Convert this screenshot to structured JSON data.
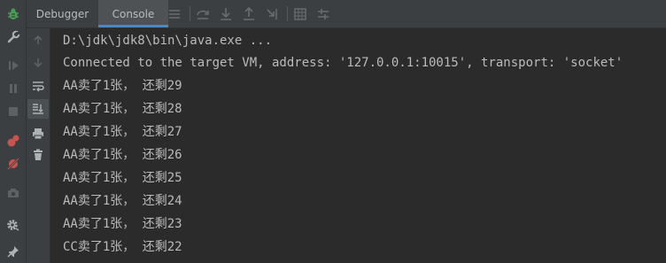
{
  "tabs": [
    {
      "label": "Debugger",
      "selected": false
    },
    {
      "label": "Console",
      "selected": true
    }
  ],
  "colors": {
    "background": "#2b2b2b",
    "panel": "#3c3f41",
    "text": "#bbbbbb",
    "accent": "#4a88c7",
    "debug_green": "#499c54",
    "breakpoint_red": "#c75450"
  },
  "left_rail_icons": [
    "debug-bug-icon",
    "wrench-icon",
    "resume-icon",
    "pause-icon",
    "stop-icon",
    "view-breakpoints-icon",
    "mute-breakpoints-icon",
    "camera-icon",
    "settings-icon",
    "pin-icon"
  ],
  "toolbar_icons": [
    "menu-lines-icon",
    "step-over-icon",
    "step-into-icon",
    "step-out-icon",
    "run-to-cursor-icon",
    "evaluate-table-icon",
    "trace-icon"
  ],
  "console": {
    "command_line": "D:\\jdk\\jdk8\\bin\\java.exe ...",
    "lines": [
      "Connected to the target VM, address: '127.0.0.1:10015', transport: 'socket'",
      "AA卖了1张， 还剩29",
      "AA卖了1张， 还剩28",
      "AA卖了1张， 还剩27",
      "AA卖了1张， 还剩26",
      "AA卖了1张， 还剩25",
      "AA卖了1张， 还剩24",
      "AA卖了1张， 还剩23",
      "CC卖了1张， 还剩22"
    ]
  }
}
